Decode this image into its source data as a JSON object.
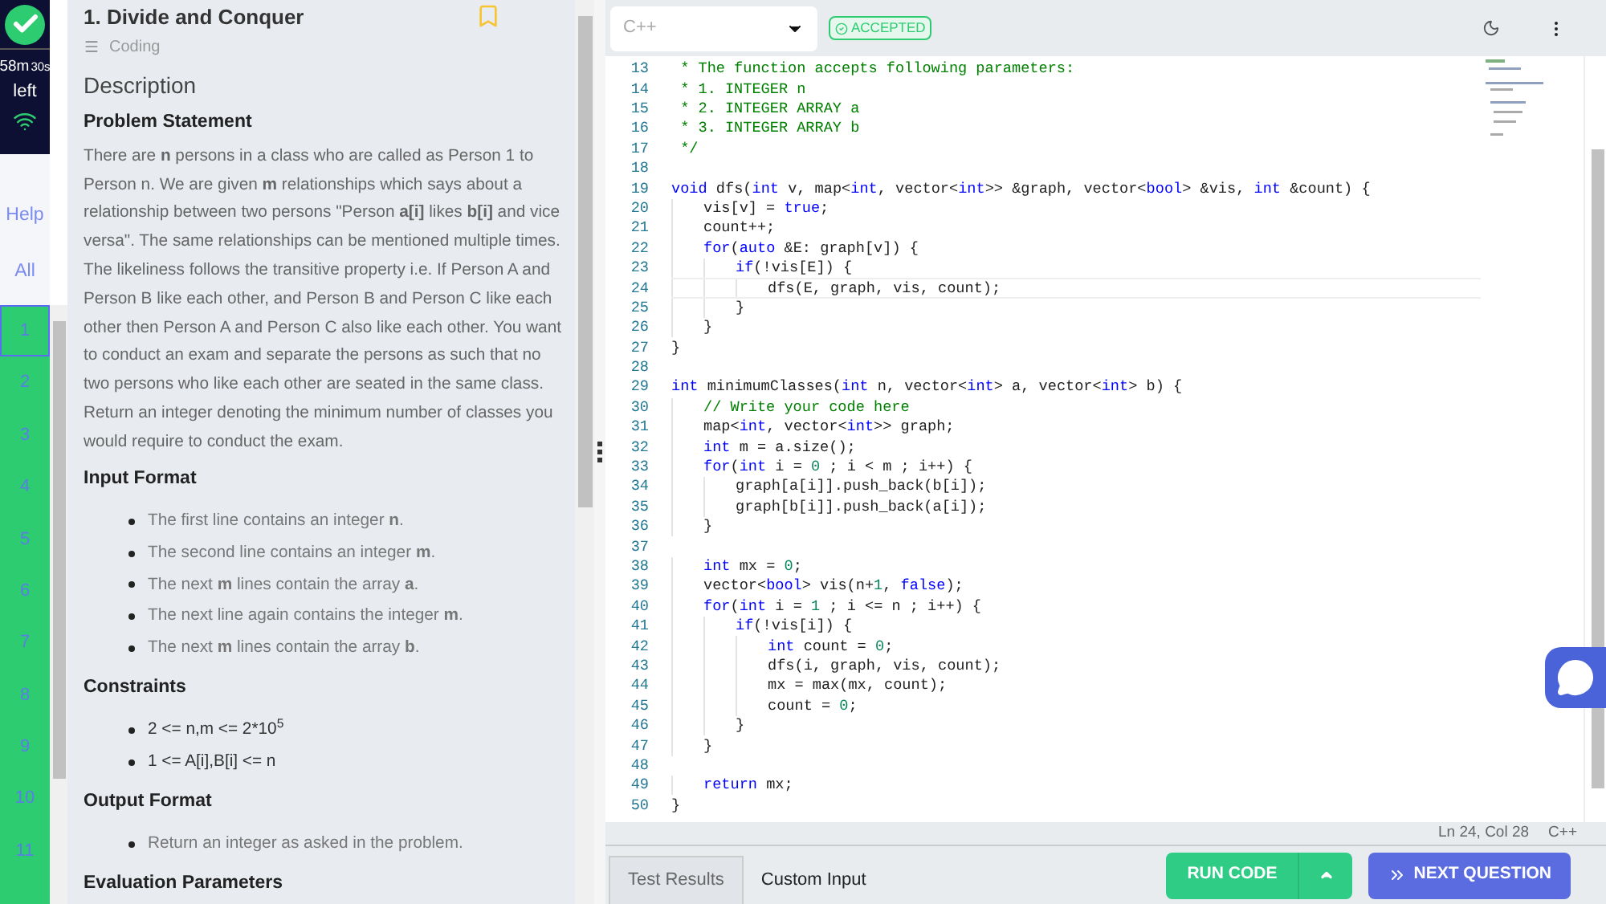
{
  "status": {
    "timer_main": "58m",
    "timer_sub": "30s",
    "timer_label": "left"
  },
  "side_links": [
    {
      "label": "Help"
    },
    {
      "label": "All"
    }
  ],
  "questions": [
    {
      "label": "1",
      "selected": true
    },
    {
      "label": "2",
      "selected": false
    },
    {
      "label": "3",
      "selected": false
    },
    {
      "label": "4",
      "selected": false
    },
    {
      "label": "5",
      "selected": false
    },
    {
      "label": "6",
      "selected": false
    },
    {
      "label": "7",
      "selected": false
    },
    {
      "label": "8",
      "selected": false
    },
    {
      "label": "9",
      "selected": false
    },
    {
      "label": "10",
      "selected": false
    },
    {
      "label": "11",
      "selected": false
    }
  ],
  "problem": {
    "title": "1. Divide and Conquer",
    "bookmarked": false,
    "category": "Coding",
    "section_title": "Description",
    "sections": [
      {
        "heading": "Problem Statement",
        "kind": "paragraph",
        "text": "There are **n** persons in a class who are called as Person 1 to Person n. We are given **m** relationships which says about a relationship between two persons \"Person **a[i]** likes **b[i]** and vice versa\". The same relationships can be mentioned multiple times. The likeliness follows the transitive property i.e. If Person A and Person B like each other, and Person B and Person C like each other then Person A and Person C also like each other. You want to conduct an exam and separate the persons as such that no two persons who like each other are seated in the same class. Return an integer denoting the minimum number of classes you would require to conduct the exam."
      },
      {
        "heading": "Input Format",
        "kind": "list",
        "items": [
          "The first line contains an integer **n**.",
          "The second line contains an integer **m**.",
          "The next **m** lines contain the array **a**.",
          "The next line again contains the integer **m**.",
          "The next **m** lines contain the array **b**."
        ]
      },
      {
        "heading": "Constraints",
        "kind": "strong_list",
        "items": [
          "2 <= n,m <= 2*10$^{5}$",
          "1 <= A[i],B[i] <= n"
        ]
      },
      {
        "heading": "Output Format",
        "kind": "list",
        "items": [
          "Return an integer as asked in the problem."
        ]
      },
      {
        "heading": "Evaluation Parameters",
        "kind": "heading_only"
      }
    ]
  },
  "editor": {
    "language": "C++",
    "verdict": "ACCEPTED",
    "lines": [
      {
        "number": "13",
        "tokens": [
          {
            "kind": "comment",
            "text": " * The function accepts following parameters:"
          }
        ]
      },
      {
        "number": "14",
        "tokens": [
          {
            "kind": "comment",
            "text": " * 1. INTEGER n"
          }
        ]
      },
      {
        "number": "15",
        "tokens": [
          {
            "kind": "comment",
            "text": " * 2. INTEGER ARRAY a"
          }
        ]
      },
      {
        "number": "16",
        "tokens": [
          {
            "kind": "comment",
            "text": " * 3. INTEGER ARRAY b"
          }
        ]
      },
      {
        "number": "17",
        "tokens": [
          {
            "kind": "comment",
            "text": " */"
          }
        ]
      },
      {
        "number": "18"
      },
      {
        "number": "19",
        "tokens": [
          {
            "kind": "keyword",
            "text": "void"
          },
          {
            "kind": "plain",
            "text": " dfs("
          },
          {
            "kind": "keyword",
            "text": "int"
          },
          {
            "kind": "plain",
            "text": " v, map<"
          },
          {
            "kind": "keyword",
            "text": "int"
          },
          {
            "kind": "plain",
            "text": ", vector<"
          },
          {
            "kind": "keyword",
            "text": "int"
          },
          {
            "kind": "plain",
            "text": ">> &graph, vector<"
          },
          {
            "kind": "keyword",
            "text": "bool"
          },
          {
            "kind": "plain",
            "text": "> &vis, "
          },
          {
            "kind": "keyword",
            "text": "int"
          },
          {
            "kind": "plain",
            "text": " &count) {"
          }
        ]
      },
      {
        "number": "20",
        "indent": [
          {
            "kind": "tab"
          }
        ],
        "tokens": [
          {
            "kind": "plain",
            "text": "vis[v] = "
          },
          {
            "kind": "keyword",
            "text": "true"
          },
          {
            "kind": "plain",
            "text": ";"
          }
        ]
      },
      {
        "number": "21",
        "indent": [
          {
            "kind": "tab"
          }
        ],
        "tokens": [
          {
            "kind": "plain",
            "text": "count++;"
          }
        ]
      },
      {
        "number": "22",
        "indent": [
          {
            "kind": "tab"
          }
        ],
        "tokens": [
          {
            "kind": "keyword",
            "text": "for"
          },
          {
            "kind": "plain",
            "text": "("
          },
          {
            "kind": "keyword",
            "text": "auto"
          },
          {
            "kind": "plain",
            "text": " &E: graph[v]) {"
          }
        ]
      },
      {
        "number": "23",
        "indent": [
          {
            "kind": "tab"
          },
          {
            "kind": "tab"
          }
        ],
        "tokens": [
          {
            "kind": "keyword",
            "text": "if"
          },
          {
            "kind": "plain",
            "text": "(!vis[E]) {"
          }
        ]
      },
      {
        "number": "24",
        "indent": [
          {
            "kind": "tab"
          },
          {
            "kind": "tab"
          },
          {
            "kind": "tab"
          }
        ],
        "current": true,
        "tokens": [
          {
            "kind": "plain",
            "text": "dfs(E, graph, vis, count);"
          }
        ]
      },
      {
        "number": "25",
        "indent": [
          {
            "kind": "tab"
          },
          {
            "kind": "tab"
          }
        ],
        "tokens": [
          {
            "kind": "plain",
            "text": "}"
          }
        ]
      },
      {
        "number": "26",
        "indent": [
          {
            "kind": "tab"
          }
        ],
        "tokens": [
          {
            "kind": "plain",
            "text": "}"
          }
        ]
      },
      {
        "number": "27",
        "tokens": [
          {
            "kind": "plain",
            "text": "}"
          }
        ]
      },
      {
        "number": "28"
      },
      {
        "number": "29",
        "tokens": [
          {
            "kind": "keyword",
            "text": "int"
          },
          {
            "kind": "plain",
            "text": " minimumClasses("
          },
          {
            "kind": "keyword",
            "text": "int"
          },
          {
            "kind": "plain",
            "text": " n, vector<"
          },
          {
            "kind": "keyword",
            "text": "int"
          },
          {
            "kind": "plain",
            "text": "> a, vector<"
          },
          {
            "kind": "keyword",
            "text": "int"
          },
          {
            "kind": "plain",
            "text": "> b) {"
          }
        ]
      },
      {
        "number": "30",
        "indent": [
          {
            "kind": "tab"
          }
        ],
        "tokens": [
          {
            "kind": "comment",
            "text": "// Write your code here"
          }
        ]
      },
      {
        "number": "31",
        "indent": [
          {
            "kind": "tab"
          }
        ],
        "tokens": [
          {
            "kind": "plain",
            "text": "map<"
          },
          {
            "kind": "keyword",
            "text": "int"
          },
          {
            "kind": "plain",
            "text": ", vector<"
          },
          {
            "kind": "keyword",
            "text": "int"
          },
          {
            "kind": "plain",
            "text": ">> graph;"
          }
        ]
      },
      {
        "number": "32",
        "indent": [
          {
            "kind": "tab"
          }
        ],
        "tokens": [
          {
            "kind": "keyword",
            "text": "int"
          },
          {
            "kind": "plain",
            "text": " m = a.size();"
          }
        ]
      },
      {
        "number": "33",
        "indent": [
          {
            "kind": "tab"
          }
        ],
        "tokens": [
          {
            "kind": "keyword",
            "text": "for"
          },
          {
            "kind": "plain",
            "text": "("
          },
          {
            "kind": "keyword",
            "text": "int"
          },
          {
            "kind": "plain",
            "text": " i = "
          },
          {
            "kind": "number",
            "text": "0"
          },
          {
            "kind": "plain",
            "text": " ; i < m ; i++) {"
          }
        ]
      },
      {
        "number": "34",
        "indent": [
          {
            "kind": "tab"
          },
          {
            "kind": "tab"
          }
        ],
        "tokens": [
          {
            "kind": "plain",
            "text": "graph[a[i]].push_back(b[i]);"
          }
        ]
      },
      {
        "number": "35",
        "indent": [
          {
            "kind": "tab"
          },
          {
            "kind": "tab"
          }
        ],
        "tokens": [
          {
            "kind": "plain",
            "text": "graph[b[i]].push_back(a[i]);"
          }
        ]
      },
      {
        "number": "36",
        "indent": [
          {
            "kind": "tab"
          }
        ],
        "tokens": [
          {
            "kind": "plain",
            "text": "}"
          }
        ]
      },
      {
        "number": "37"
      },
      {
        "number": "38",
        "indent": [
          {
            "kind": "tab"
          }
        ],
        "tokens": [
          {
            "kind": "keyword",
            "text": "int"
          },
          {
            "kind": "plain",
            "text": " mx = "
          },
          {
            "kind": "number",
            "text": "0"
          },
          {
            "kind": "plain",
            "text": ";"
          }
        ]
      },
      {
        "number": "39",
        "indent": [
          {
            "kind": "tab"
          }
        ],
        "tokens": [
          {
            "kind": "plain",
            "text": "vector<"
          },
          {
            "kind": "keyword",
            "text": "bool"
          },
          {
            "kind": "plain",
            "text": "> vis(n+"
          },
          {
            "kind": "number",
            "text": "1"
          },
          {
            "kind": "plain",
            "text": ", "
          },
          {
            "kind": "keyword",
            "text": "false"
          },
          {
            "kind": "plain",
            "text": ");"
          }
        ]
      },
      {
        "number": "40",
        "indent": [
          {
            "kind": "tab"
          }
        ],
        "tokens": [
          {
            "kind": "keyword",
            "text": "for"
          },
          {
            "kind": "plain",
            "text": "("
          },
          {
            "kind": "keyword",
            "text": "int"
          },
          {
            "kind": "plain",
            "text": " i = "
          },
          {
            "kind": "number",
            "text": "1"
          },
          {
            "kind": "plain",
            "text": " ; i <= n ; i++) {"
          }
        ]
      },
      {
        "number": "41",
        "indent": [
          {
            "kind": "tab"
          },
          {
            "kind": "tab"
          }
        ],
        "tokens": [
          {
            "kind": "keyword",
            "text": "if"
          },
          {
            "kind": "plain",
            "text": "(!vis[i]) {"
          }
        ]
      },
      {
        "number": "42",
        "indent": [
          {
            "kind": "tab"
          },
          {
            "kind": "tab"
          },
          {
            "kind": "tab"
          }
        ],
        "tokens": [
          {
            "kind": "keyword",
            "text": "int"
          },
          {
            "kind": "plain",
            "text": " count = "
          },
          {
            "kind": "number",
            "text": "0"
          },
          {
            "kind": "plain",
            "text": ";"
          }
        ]
      },
      {
        "number": "43",
        "indent": [
          {
            "kind": "tab"
          },
          {
            "kind": "tab"
          },
          {
            "kind": "tab"
          }
        ],
        "tokens": [
          {
            "kind": "plain",
            "text": "dfs(i, graph, vis, count);"
          }
        ]
      },
      {
        "number": "44",
        "indent": [
          {
            "kind": "tab"
          },
          {
            "kind": "tab"
          },
          {
            "kind": "tab"
          }
        ],
        "tokens": [
          {
            "kind": "plain",
            "text": "mx = max(mx, count);"
          }
        ]
      },
      {
        "number": "45",
        "indent": [
          {
            "kind": "tab"
          },
          {
            "kind": "tab"
          },
          {
            "kind": "tab"
          }
        ],
        "tokens": [
          {
            "kind": "plain",
            "text": "count = "
          },
          {
            "kind": "number",
            "text": "0"
          },
          {
            "kind": "plain",
            "text": ";"
          }
        ]
      },
      {
        "number": "46",
        "indent": [
          {
            "kind": "tab"
          },
          {
            "kind": "tab"
          }
        ],
        "tokens": [
          {
            "kind": "plain",
            "text": "}"
          }
        ]
      },
      {
        "number": "47",
        "indent": [
          {
            "kind": "tab"
          }
        ],
        "tokens": [
          {
            "kind": "plain",
            "text": "}"
          }
        ]
      },
      {
        "number": "48"
      },
      {
        "number": "49",
        "indent": [
          {
            "kind": "tab"
          }
        ],
        "tokens": [
          {
            "kind": "keyword",
            "text": "return"
          },
          {
            "kind": "plain",
            "text": " mx;"
          }
        ]
      },
      {
        "number": "50",
        "tokens": [
          {
            "kind": "plain",
            "text": "}"
          }
        ]
      }
    ],
    "cursor": "Ln 24, Col 28",
    "mode": "C++"
  },
  "bottom_tabs": [
    {
      "label": "Test Results",
      "selected": true
    },
    {
      "label": "Custom Input",
      "selected": false
    }
  ],
  "actions": {
    "run": "RUN CODE",
    "next": "NEXT QUESTION"
  }
}
